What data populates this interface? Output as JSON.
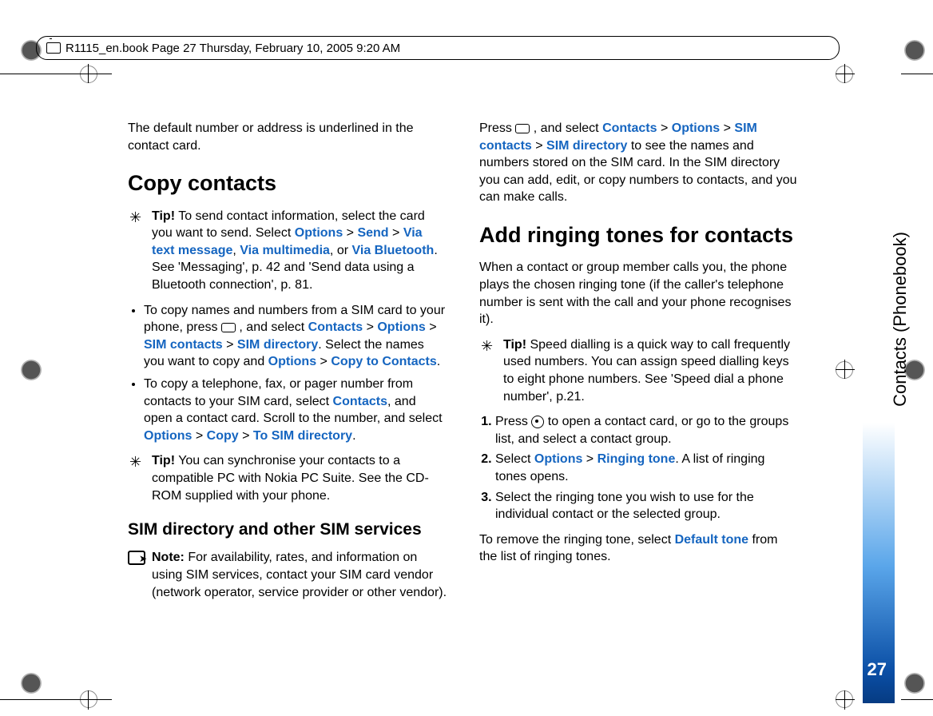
{
  "header": {
    "text": "R1115_en.book  Page 27  Thursday, February 10, 2005  9:20 AM"
  },
  "sidebar": {
    "section": "Contacts (Phonebook)",
    "pageNumber": "27"
  },
  "left": {
    "intro": "The default number or address is underlined in the contact card.",
    "h1": "Copy contacts",
    "tip1_label": "Tip!",
    "tip1_a": " To send contact information, select the card you want to send. Select ",
    "options": "Options",
    "gt": " > ",
    "send": "Send",
    "via_text": "Via text message",
    "comma": ", ",
    "via_mm": "Via multimedia",
    "or": ", or ",
    "via_bt": "Via Bluetooth",
    "tip1_c": ". See 'Messaging', p. 42 and 'Send data using a Bluetooth connection', p. 81.",
    "bullet1_a": "To copy names and numbers from a SIM card to your phone, press ",
    "bullet1_b": " , and select ",
    "contacts": "Contacts",
    "sim_contacts": "SIM contacts",
    "sim_directory": "SIM directory",
    "bullet1_c": ". Select the names you want to copy and ",
    "copy_to_contacts": "Copy to Contacts",
    "period": ".",
    "bullet2_a": "To copy a telephone, fax, or pager number from contacts to your SIM card, select ",
    "bullet2_b": ", and open a contact card. Scroll to the number, and select ",
    "copy": "Copy",
    "to_sim_dir": "To SIM directory",
    "tip2_label": "Tip!",
    "tip2": " You can synchronise your contacts to a compatible PC with Nokia PC Suite. See the CD-ROM supplied with your phone.",
    "h2": "SIM directory and other SIM services",
    "note_label": "Note:",
    "note": " For availability, rates, and information on using SIM services, contact your SIM card vendor (network operator, service provider or other vendor)."
  },
  "right": {
    "para1_a": "Press ",
    "para1_b": " , and select ",
    "para1_c": " to see the names and numbers stored on the SIM card. In the SIM directory you can add, edit, or copy numbers to contacts, and you can make calls.",
    "h1": "Add ringing tones for contacts",
    "para2": "When a contact or group member calls you, the phone plays the chosen ringing tone (if the caller's telephone number is sent with the call and your phone recognises it).",
    "tip_label": "Tip!",
    "tip": " Speed dialling is a quick way to call frequently used numbers. You can assign speed dialling keys to eight phone numbers. See 'Speed dial a phone number', p.21.",
    "step1_a": "Press ",
    "step1_b": " to open a contact card, or go to the groups list, and select a contact group.",
    "step2_a": "Select ",
    "ringing_tone": "Ringing tone",
    "step2_b": ". A list of ringing tones opens.",
    "step3": "Select the ringing tone you wish to use for the individual contact or the selected group.",
    "para3_a": "To remove the ringing tone, select ",
    "default_tone": "Default tone",
    "para3_b": " from the list of ringing tones."
  }
}
